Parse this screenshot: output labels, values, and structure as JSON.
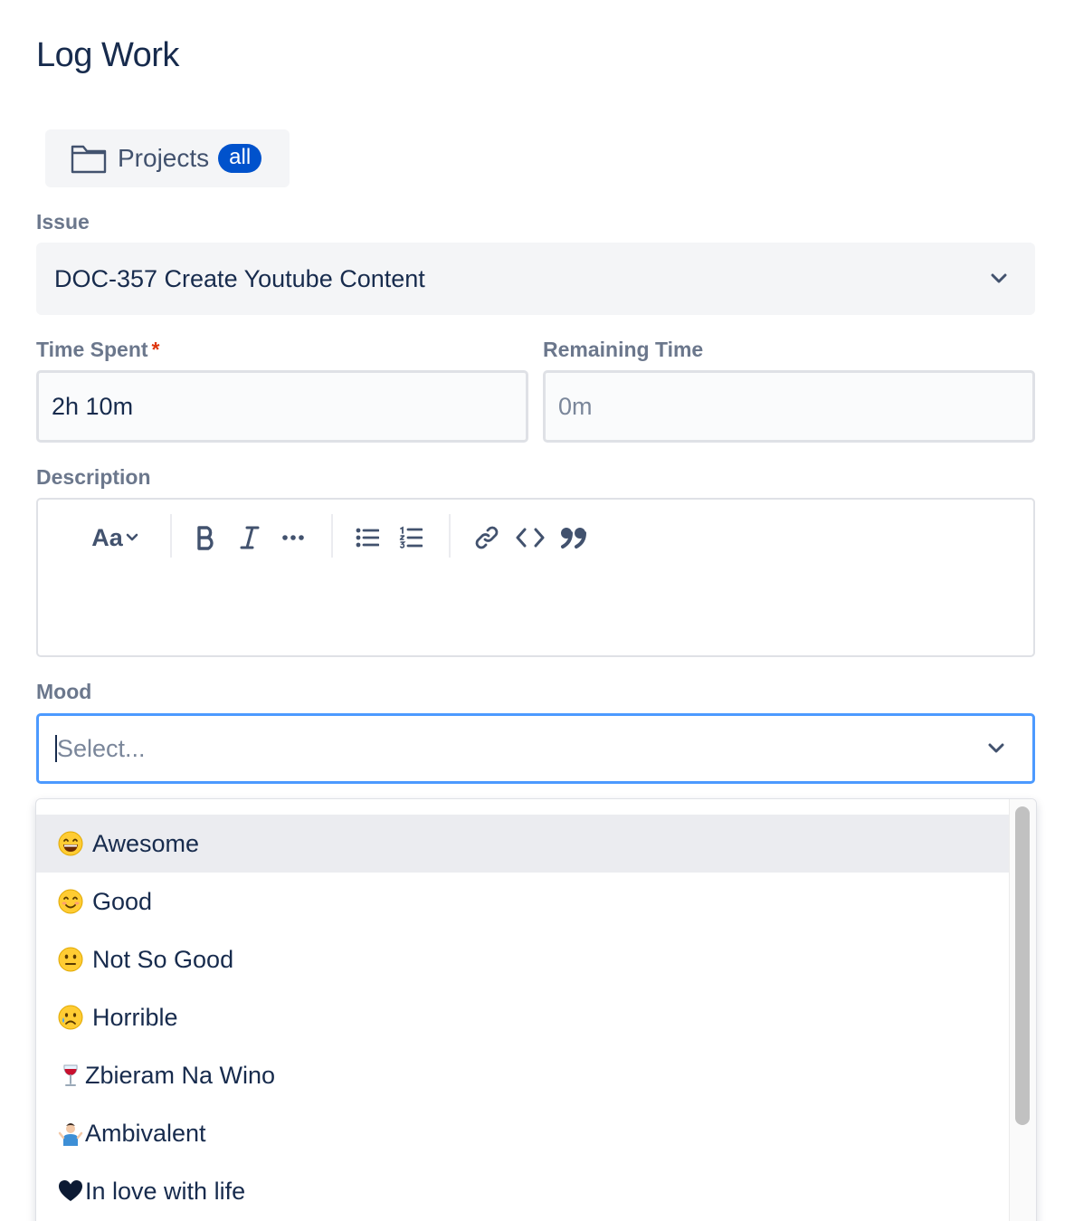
{
  "page": {
    "title": "Log Work"
  },
  "projects": {
    "label": "Projects",
    "badge": "all"
  },
  "issue": {
    "label": "Issue",
    "value": "DOC-357 Create Youtube Content"
  },
  "time_spent": {
    "label": "Time Spent",
    "required_mark": "*",
    "value": "2h 10m"
  },
  "remaining_time": {
    "label": "Remaining Time",
    "placeholder": "0m"
  },
  "description": {
    "label": "Description",
    "toolbar": {
      "text_style": "Aa"
    }
  },
  "mood": {
    "label": "Mood",
    "placeholder": "Select...",
    "options": [
      {
        "label": "Awesome",
        "icon": "grinning-face-icon"
      },
      {
        "label": "Good",
        "icon": "smiling-face-icon"
      },
      {
        "label": "Not So Good",
        "icon": "neutral-face-icon"
      },
      {
        "label": "Horrible",
        "icon": "sad-face-icon"
      },
      {
        "label": "Zbieram Na Wino",
        "icon": "wine-glass-icon"
      },
      {
        "label": "Ambivalent",
        "icon": "shrugging-person-icon"
      },
      {
        "label": "In love with life",
        "icon": "heart-icon"
      }
    ]
  },
  "colors": {
    "accent": "#0052cc",
    "focus_border": "#4c9aff",
    "required": "#de350b"
  }
}
